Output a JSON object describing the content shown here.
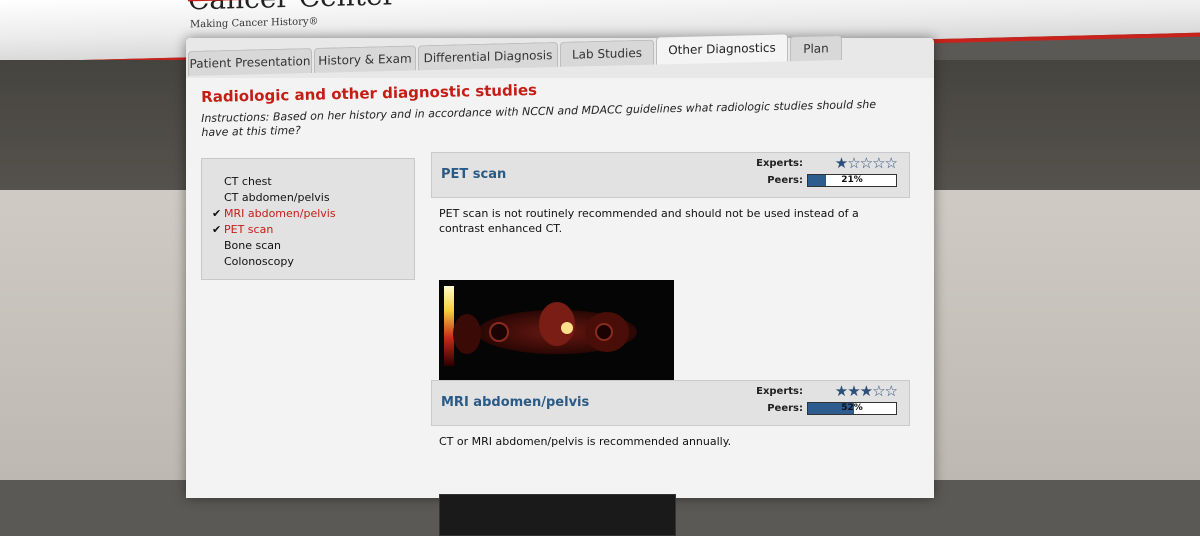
{
  "header": {
    "logo_text": "Cancer Center",
    "tagline": "Making Cancer History®"
  },
  "tabs": [
    {
      "label": "Patient Presentation"
    },
    {
      "label": "History & Exam"
    },
    {
      "label": "Differential Diagnosis"
    },
    {
      "label": "Lab Studies"
    },
    {
      "label": "Other Diagnostics"
    },
    {
      "label": "Plan"
    }
  ],
  "active_tab": "Other Diagnostics",
  "section": {
    "title": "Radiologic and other diagnostic studies",
    "instructions": "Instructions: Based on her history and in accordance with NCCN and MDACC guidelines what radiologic studies should she have at this time?"
  },
  "options": [
    {
      "label": "CT chest",
      "selected": false
    },
    {
      "label": "CT abdomen/pelvis",
      "selected": false
    },
    {
      "label": "MRI abdomen/pelvis",
      "selected": true
    },
    {
      "label": "PET scan",
      "selected": true
    },
    {
      "label": "Bone scan",
      "selected": false
    },
    {
      "label": "Colonoscopy",
      "selected": false
    }
  ],
  "check_glyph": "✔",
  "cards": [
    {
      "title": "PET scan",
      "experts_label": "Experts:",
      "experts_stars": 1,
      "peers_label": "Peers:",
      "peers_value": 0.21,
      "peers_text": "21%",
      "description": "PET scan is not routinely recommended and should not be used instead of a contrast enhanced CT."
    },
    {
      "title": "MRI abdomen/pelvis",
      "experts_label": "Experts:",
      "experts_stars": 3,
      "peers_label": "Peers:",
      "peers_value": 0.52,
      "peers_text": "52%",
      "description": "CT or MRI abdomen/pelvis is recommended annually."
    }
  ],
  "colors": {
    "brand_red": "#c41d14",
    "title_blue": "#2a5a86",
    "star_blue": "#2c4f78"
  }
}
